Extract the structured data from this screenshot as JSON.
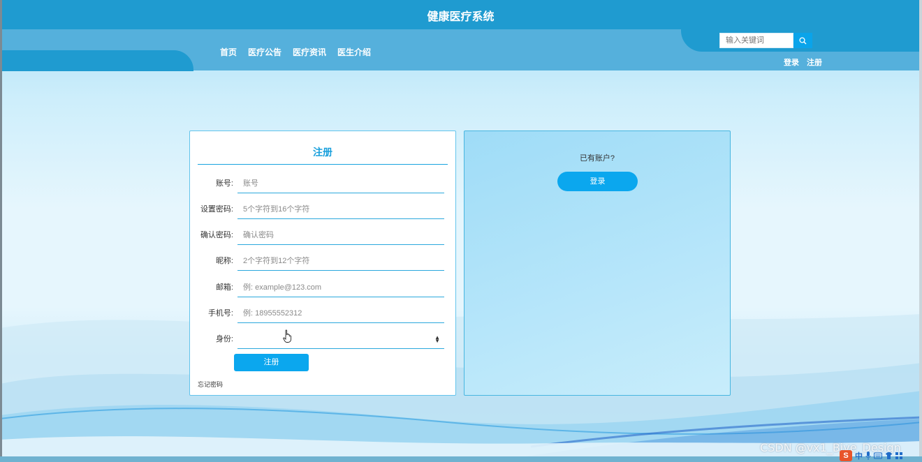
{
  "header": {
    "site_title": "健康医疗系统",
    "nav": [
      "首页",
      "医疗公告",
      "医疗资讯",
      "医生介绍"
    ],
    "search_placeholder": "输入关键词",
    "auth": {
      "login": "登录",
      "register": "注册"
    }
  },
  "register": {
    "title": "注册",
    "fields": [
      {
        "label": "账号:",
        "placeholder": "账号"
      },
      {
        "label": "设置密码:",
        "placeholder": "5个字符到16个字符"
      },
      {
        "label": "确认密码:",
        "placeholder": "确认密码"
      },
      {
        "label": "昵称:",
        "placeholder": "2个字符到12个字符"
      },
      {
        "label": "邮箱:",
        "placeholder": "例: example@123.com"
      },
      {
        "label": "手机号:",
        "placeholder": "例: 18955552312"
      }
    ],
    "role_label": "身份:",
    "role_value": "",
    "submit": "注册",
    "forgot": "忘记密码"
  },
  "login_panel": {
    "prompt": "已有账户?",
    "button": "登录"
  },
  "footer": {
    "watermark": "CSDN @vx1_Biye_Design",
    "ime": {
      "logo": "S",
      "lang": "中"
    }
  },
  "colors": {
    "header_dark": "#1f9bd0",
    "header_light": "#55b0dc",
    "accent": "#0ba7ee",
    "border": "#2aa8dd"
  },
  "icons": [
    "search-icon",
    "hand-cursor-icon",
    "select-arrow-icon",
    "mic-icon",
    "keyboard-icon"
  ]
}
